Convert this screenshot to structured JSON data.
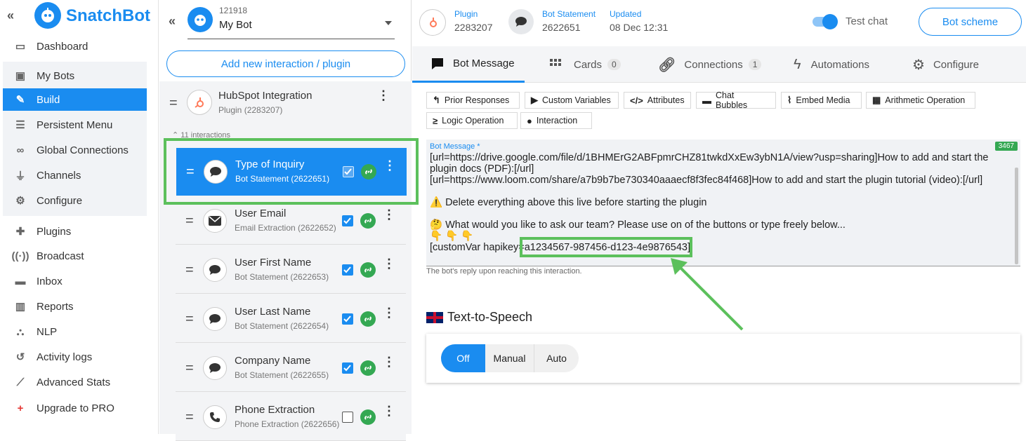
{
  "sidebar": {
    "brand": "SnatchBot",
    "items": [
      {
        "label": "Dashboard",
        "icon": "dashboard-icon"
      },
      {
        "label": "My Bots",
        "icon": "robot-icon"
      },
      {
        "label": "Build",
        "icon": "edit-icon"
      },
      {
        "label": "Persistent Menu",
        "icon": "menu-icon"
      },
      {
        "label": "Global Connections",
        "icon": "link-icon"
      },
      {
        "label": "Channels",
        "icon": "plug-icon"
      },
      {
        "label": "Configure",
        "icon": "gear-icon"
      },
      {
        "label": "Plugins",
        "icon": "puzzle-icon"
      },
      {
        "label": "Broadcast",
        "icon": "broadcast-icon"
      },
      {
        "label": "Inbox",
        "icon": "chat-icon"
      },
      {
        "label": "Reports",
        "icon": "bar-chart-icon"
      },
      {
        "label": "NLP",
        "icon": "nlp-icon"
      },
      {
        "label": "Activity logs",
        "icon": "history-icon"
      },
      {
        "label": "Advanced Stats",
        "icon": "line-chart-icon"
      },
      {
        "label": "Upgrade to PRO",
        "icon": "plus-icon"
      }
    ]
  },
  "bot": {
    "id": "121918",
    "name": "My Bot"
  },
  "middle": {
    "add_button": "Add new interaction / plugin",
    "plugin": {
      "title": "HubSpot Integration",
      "subtitle": "Plugin (2283207)"
    },
    "interactions_count": "11 interactions",
    "rows": [
      {
        "title": "Type of Inquiry",
        "subtitle": "Bot Statement (2622651)",
        "checked": true,
        "icon": "speech-bubble-icon"
      },
      {
        "title": "User Email",
        "subtitle": "Email Extraction (2622652)",
        "checked": true,
        "icon": "envelope-icon"
      },
      {
        "title": "User First Name",
        "subtitle": "Bot Statement (2622653)",
        "checked": true,
        "icon": "speech-bubble-icon"
      },
      {
        "title": "User Last Name",
        "subtitle": "Bot Statement (2622654)",
        "checked": true,
        "icon": "speech-bubble-icon"
      },
      {
        "title": "Company Name",
        "subtitle": "Bot Statement (2622655)",
        "checked": true,
        "icon": "speech-bubble-icon"
      },
      {
        "title": "Phone Extraction",
        "subtitle": "Phone Extraction (2622656)",
        "checked": false,
        "icon": "phone-icon"
      }
    ]
  },
  "header": {
    "plugin_label": "Plugin",
    "plugin_id": "2283207",
    "statement_label": "Bot Statement",
    "statement_id": "2622651",
    "updated_label": "Updated",
    "updated_value": "08 Dec 12:31",
    "test_chat": "Test chat",
    "scheme_button": "Bot scheme"
  },
  "tabs": [
    {
      "label": "Bot Message",
      "count": ""
    },
    {
      "label": "Cards",
      "count": "0"
    },
    {
      "label": "Connections",
      "count": "1"
    },
    {
      "label": "Automations",
      "count": ""
    },
    {
      "label": "Configure",
      "count": ""
    }
  ],
  "toolbar": [
    "Prior Responses",
    "Custom Variables",
    "Attributes",
    "Chat Bubbles",
    "Embed Media",
    "Arithmetic Operation",
    "Logic Operation",
    "Interaction"
  ],
  "message": {
    "label": "Bot Message *",
    "char_count": "3467",
    "line1": "[url=https://drive.google.com/file/d/1BHMErG2ABFpmrCHZ81twkdXxEw3ybN1A/view?usp=sharing]How to add and start the plugin docs (PDF):[/url]",
    "line2": "[url=https://www.loom.com/share/a7b9b7be730340aaaecf8f3fec84f468]How to add and start the plugin tutorial (video):[/url]",
    "line3": "⚠️ Delete everything above this live before starting the plugin",
    "line4": "🤔 What would you like to ask our team? Please use on of the buttons or type freely below...",
    "line5": "👇 👇 👇",
    "line6a": "[customVar hapikey=",
    "line6b": "a1234567-987456-d123-4e9876543]",
    "hint": "The bot's reply upon reaching this interaction."
  },
  "tts": {
    "title": "Text-to-Speech",
    "options": [
      "Off",
      "Manual",
      "Auto"
    ],
    "selected": "Off"
  }
}
